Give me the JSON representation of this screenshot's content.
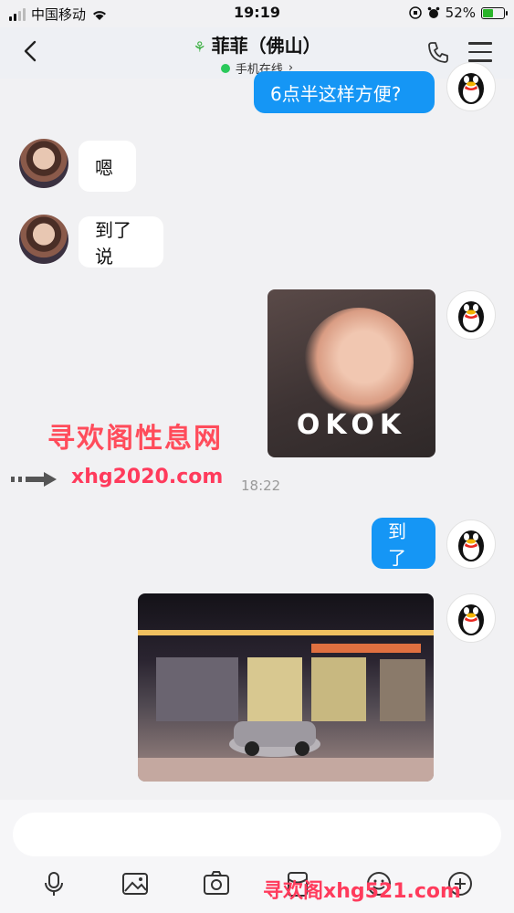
{
  "status_bar": {
    "carrier": "中国移动",
    "time": "19:19",
    "battery_percent": "52%",
    "battery_level": 0.52
  },
  "header": {
    "contact_name": "菲菲（佛山）",
    "status": "手机在线",
    "status_color": "#2ac95b"
  },
  "messages": [
    {
      "side": "out",
      "type": "text",
      "text": "6点半这样方便?"
    },
    {
      "side": "in",
      "type": "text",
      "text": "嗯"
    },
    {
      "side": "in",
      "type": "text",
      "text": "到了说"
    },
    {
      "side": "out",
      "type": "sticker",
      "text": "OKOK"
    },
    {
      "side": "out",
      "type": "text",
      "text": "到了"
    },
    {
      "side": "out",
      "type": "image"
    }
  ],
  "timestamp": "18:22",
  "watermarks": {
    "line1": "寻欢阁性息网",
    "line2": "xhg2020.com",
    "line3": "寻欢阁xhg521.com"
  },
  "colors": {
    "outgoing_bubble": "#1596f5",
    "incoming_bubble": "#ffffff",
    "watermark": "#ff3b5c"
  },
  "toolbar": {
    "icons": [
      "microphone-icon",
      "image-icon",
      "camera-icon",
      "red-packet-icon",
      "emoji-icon",
      "plus-icon"
    ]
  }
}
